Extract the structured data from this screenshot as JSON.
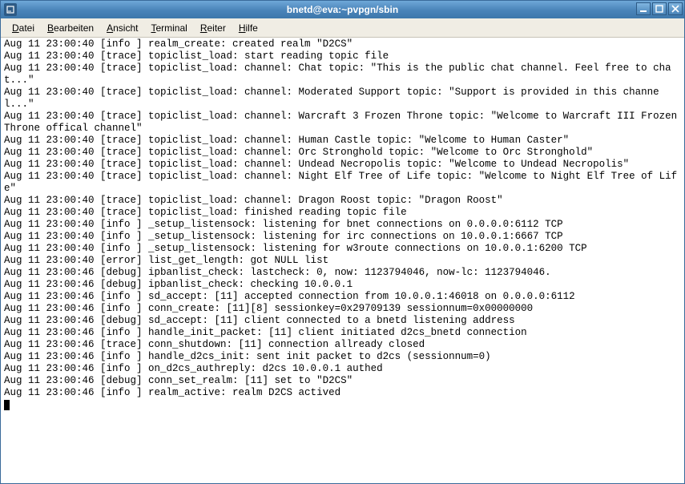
{
  "window": {
    "title": "bnetd@eva:~pvpgn/sbin"
  },
  "menubar": {
    "items": [
      {
        "label": "Datei",
        "accel_index": 0
      },
      {
        "label": "Bearbeiten",
        "accel_index": 0
      },
      {
        "label": "Ansicht",
        "accel_index": 0
      },
      {
        "label": "Terminal",
        "accel_index": 0
      },
      {
        "label": "Reiter",
        "accel_index": 0
      },
      {
        "label": "Hilfe",
        "accel_index": 0
      }
    ]
  },
  "log": [
    "Aug 11 23:00:40 [info ] realm_create: created realm \"D2CS\"",
    "Aug 11 23:00:40 [trace] topiclist_load: start reading topic file",
    "Aug 11 23:00:40 [trace] topiclist_load: channel: Chat topic: \"This is the public chat channel. Feel free to chat...\"",
    "Aug 11 23:00:40 [trace] topiclist_load: channel: Moderated Support topic: \"Support is provided in this channel...\"",
    "Aug 11 23:00:40 [trace] topiclist_load: channel: Warcraft 3 Frozen Throne topic: \"Welcome to Warcraft III Frozen Throne offical channel\"",
    "Aug 11 23:00:40 [trace] topiclist_load: channel: Human Castle topic: \"Welcome to Human Caster\"",
    "Aug 11 23:00:40 [trace] topiclist_load: channel: Orc Stronghold topic: \"Welcome to Orc Stronghold\"",
    "Aug 11 23:00:40 [trace] topiclist_load: channel: Undead Necropolis topic: \"Welcome to Undead Necropolis\"",
    "Aug 11 23:00:40 [trace] topiclist_load: channel: Night Elf Tree of Life topic: \"Welcome to Night Elf Tree of Life\"",
    "Aug 11 23:00:40 [trace] topiclist_load: channel: Dragon Roost topic: \"Dragon Roost\"",
    "Aug 11 23:00:40 [trace] topiclist_load: finished reading topic file",
    "Aug 11 23:00:40 [info ] _setup_listensock: listening for bnet connections on 0.0.0.0:6112 TCP",
    "Aug 11 23:00:40 [info ] _setup_listensock: listening for irc connections on 10.0.0.1:6667 TCP",
    "Aug 11 23:00:40 [info ] _setup_listensock: listening for w3route connections on 10.0.0.1:6200 TCP",
    "Aug 11 23:00:40 [error] list_get_length: got NULL list",
    "Aug 11 23:00:46 [debug] ipbanlist_check: lastcheck: 0, now: 1123794046, now-lc: 1123794046.",
    "Aug 11 23:00:46 [debug] ipbanlist_check: checking 10.0.0.1",
    "Aug 11 23:00:46 [info ] sd_accept: [11] accepted connection from 10.0.0.1:46018 on 0.0.0.0:6112",
    "Aug 11 23:00:46 [info ] conn_create: [11][8] sessionkey=0x29709139 sessionnum=0x00000000",
    "Aug 11 23:00:46 [debug] sd_accept: [11] client connected to a bnetd listening address",
    "Aug 11 23:00:46 [info ] handle_init_packet: [11] client initiated d2cs_bnetd connection",
    "Aug 11 23:00:46 [trace] conn_shutdown: [11] connection allready closed",
    "Aug 11 23:00:46 [info ] handle_d2cs_init: sent init packet to d2cs (sessionnum=0)",
    "Aug 11 23:00:46 [info ] on_d2cs_authreply: d2cs 10.0.0.1 authed",
    "Aug 11 23:00:46 [debug] conn_set_realm: [11] set to \"D2CS\"",
    "Aug 11 23:00:46 [info ] realm_active: realm D2CS actived"
  ]
}
